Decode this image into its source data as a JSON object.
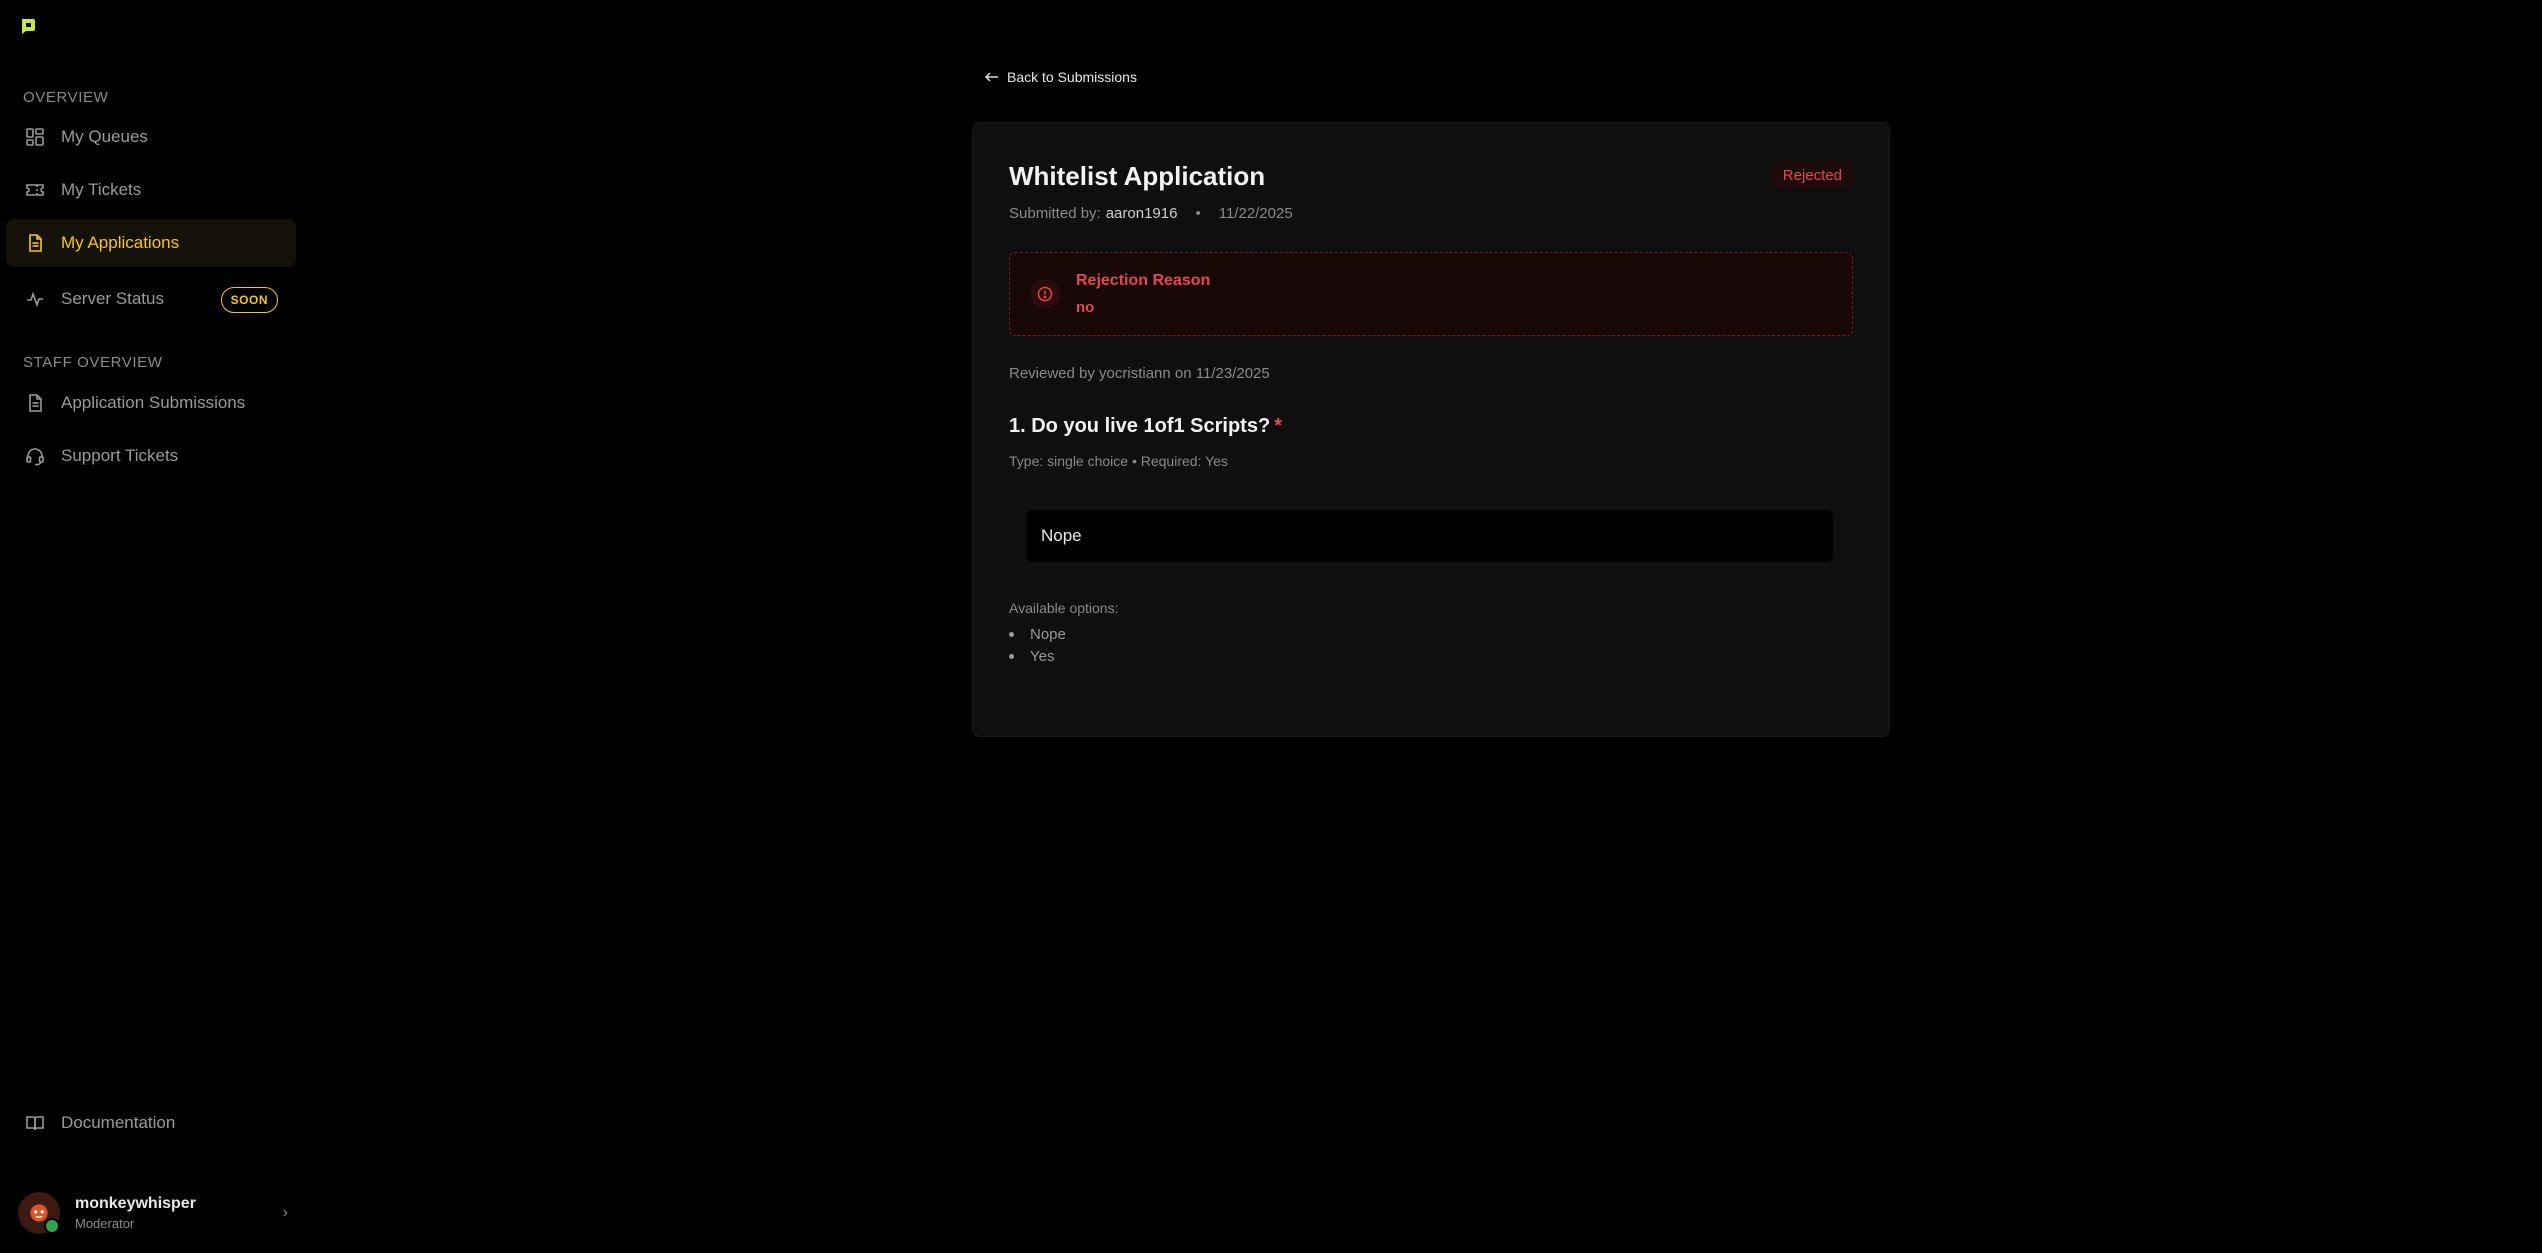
{
  "sidebar": {
    "overview_label": "OVERVIEW",
    "items": [
      {
        "label": "My Queues",
        "icon": "grid-icon"
      },
      {
        "label": "My Tickets",
        "icon": "ticket-icon"
      },
      {
        "label": "My Applications",
        "icon": "file-icon",
        "active": true
      },
      {
        "label": "Server Status",
        "icon": "activity-icon",
        "badge": "SOON"
      }
    ],
    "staff_label": "STAFF OVERVIEW",
    "staff_items": [
      {
        "label": "Application Submissions",
        "icon": "file-icon"
      },
      {
        "label": "Support Tickets",
        "icon": "headset-icon"
      }
    ],
    "documentation_label": "Documentation",
    "user": {
      "name": "monkeywhisper",
      "role": "Moderator",
      "status": "online"
    }
  },
  "main": {
    "back_label": "Back to Submissions",
    "title": "Whitelist Application",
    "status": "Rejected",
    "submitted_by_label": "Submitted by:",
    "submitted_by": "aaron1916",
    "separator": "•",
    "submitted_date": "11/22/2025",
    "rejection": {
      "title": "Rejection Reason",
      "reason": "no"
    },
    "reviewed": "Reviewed by yocristiann on 11/23/2025",
    "question": {
      "text": "1. Do you live 1of1 Scripts?",
      "required_marker": "*",
      "meta": "Type: single choice • Required: Yes",
      "answer": "Nope",
      "options_label": "Available options:",
      "options": [
        "Nope",
        "Yes"
      ]
    }
  },
  "colors": {
    "accent": "#f5c518",
    "danger": "#e5484d",
    "background": "#000000",
    "card": "#0f0f0f"
  }
}
